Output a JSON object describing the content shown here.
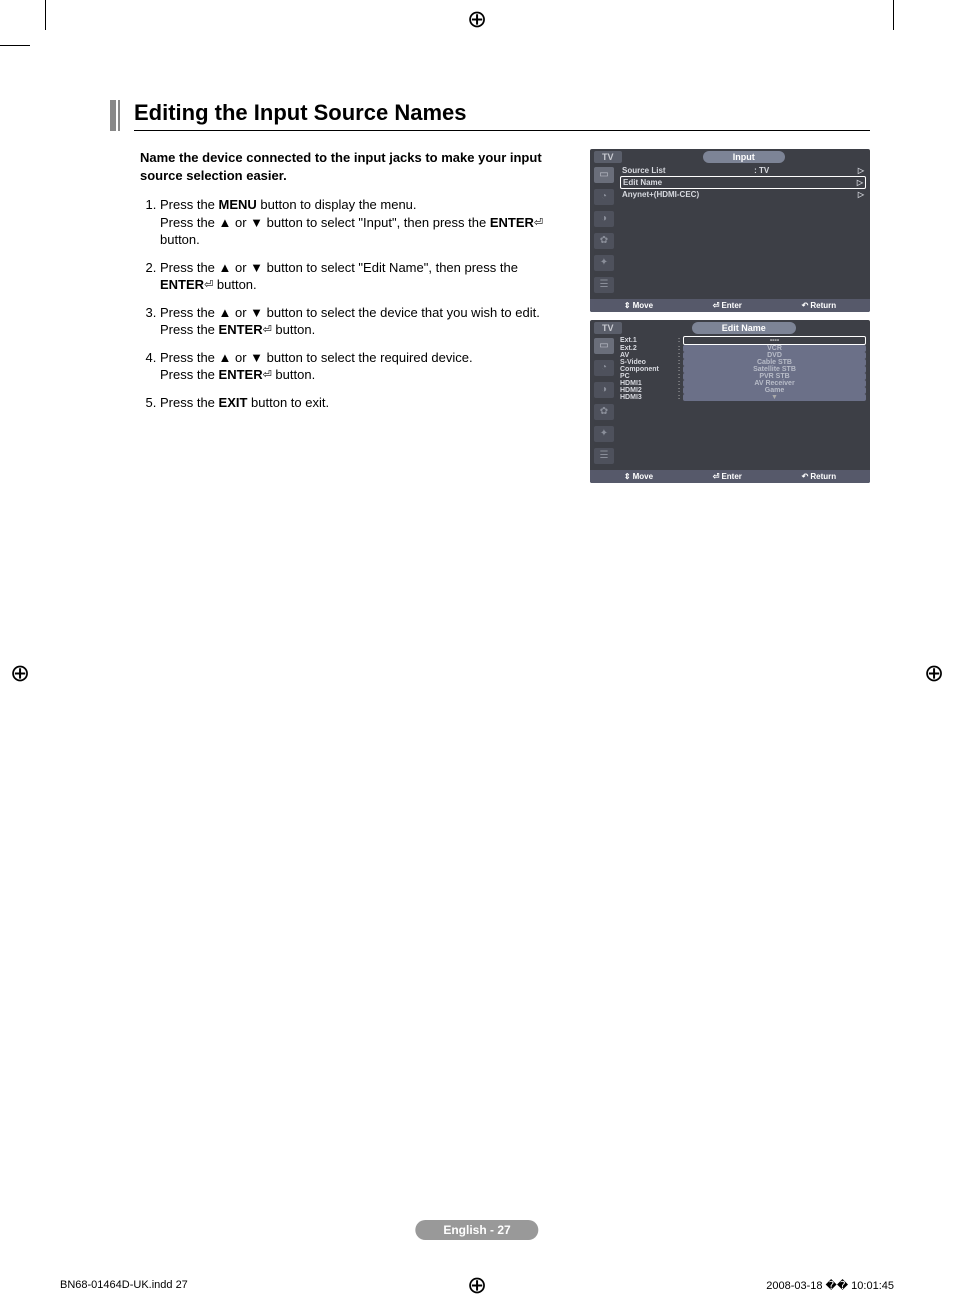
{
  "title": "Editing the Input Source Names",
  "intro": "Name the device connected to the input jacks to make your input source selection easier.",
  "steps": {
    "s1a": "Press the ",
    "s1a_bold": "MENU",
    "s1b": " button to display the menu.",
    "s1c": "Press the ▲ or ▼ button to select \"Input\", then press the ",
    "s1c_bold": "ENTER",
    "s1d": " button.",
    "s2a": "Press the ▲ or ▼ button to select \"Edit Name\", then press the ",
    "s2a_bold": "ENTER",
    "s2b": " button.",
    "s3a": "Press the ▲ or ▼ button to select the device that you wish to edit.",
    "s3b": "Press the ",
    "s3b_bold": "ENTER",
    "s3c": " button.",
    "s4a": "Press the ▲ or ▼ button to select the required device.",
    "s4b": "Press the ",
    "s4b_bold": "ENTER",
    "s4c": " button.",
    "s5a": "Press the ",
    "s5a_bold": "EXIT",
    "s5b": " button to exit."
  },
  "osd1": {
    "tv": "TV",
    "title": "Input",
    "rows": {
      "r1_label": "Source List",
      "r1_value": ": TV",
      "r2_label": "Edit Name",
      "r3_label": "Anynet+(HDMI-CEC)"
    },
    "footer": {
      "move": "Move",
      "enter": "Enter",
      "return": "Return"
    }
  },
  "osd2": {
    "tv": "TV",
    "title": "Edit Name",
    "labels": [
      "Ext.1",
      "Ext.2",
      "AV",
      "S-Video",
      "Component",
      "PC",
      "HDMI1",
      "HDMI2",
      "HDMI3"
    ],
    "values": [
      "----",
      "VCR",
      "DVD",
      "Cable STB",
      "Satellite STB",
      "PVR STB",
      "AV Receiver",
      "Game"
    ],
    "footer": {
      "move": "Move",
      "enter": "Enter",
      "return": "Return"
    }
  },
  "page_footer": "English - 27",
  "indd": {
    "left": "BN68-01464D-UK.indd   27",
    "right": "2008-03-18   �� 10:01:45"
  }
}
